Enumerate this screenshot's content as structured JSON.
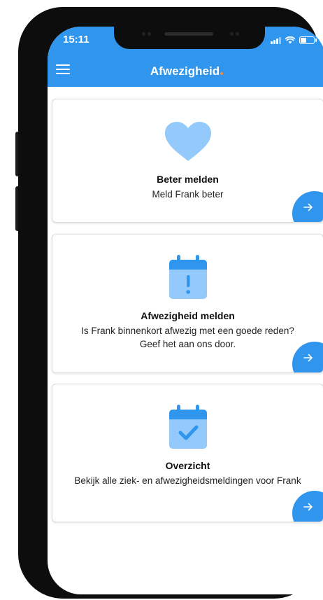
{
  "status_bar": {
    "time": "15:11"
  },
  "app_bar": {
    "title": "Afwezigheid"
  },
  "cards": [
    {
      "title": "Beter melden",
      "description": "Meld Frank beter",
      "icon": "heart-icon"
    },
    {
      "title": "Afwezigheid melden",
      "description": "Is Frank binnenkort afwezig met een goede reden? Geef het aan ons door.",
      "icon": "calendar-alert-icon"
    },
    {
      "title": "Overzicht",
      "description": "Bekijk alle ziek- en afwezigheidsmeldingen voor Frank",
      "icon": "calendar-check-icon"
    }
  ],
  "colors": {
    "primary": "#2f95ed",
    "icon_light": "#93c9fb",
    "accent_dot": "#f28c28"
  }
}
